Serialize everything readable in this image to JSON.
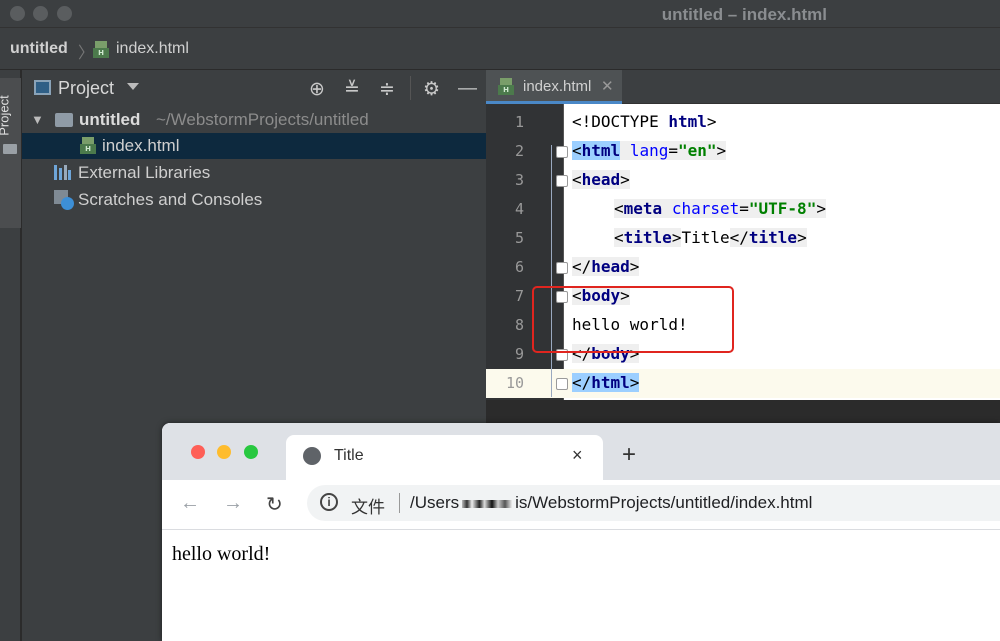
{
  "ide": {
    "window_title": "untitled – index.html",
    "breadcrumb": {
      "project": "untitled",
      "file": "index.html"
    },
    "left_stripe": {
      "label": "Project"
    },
    "project_panel": {
      "title": "Project",
      "tree": [
        {
          "label": "untitled",
          "path": "~/WebstormProjects/untitled",
          "type": "folder"
        },
        {
          "label": "index.html",
          "type": "html-file"
        },
        {
          "label": "External Libraries",
          "type": "libraries"
        },
        {
          "label": "Scratches and Consoles",
          "type": "scratches"
        }
      ]
    },
    "editor": {
      "tab_label": "index.html",
      "line_numbers": [
        "1",
        "2",
        "3",
        "4",
        "5",
        "6",
        "7",
        "8",
        "9",
        "10"
      ],
      "code": {
        "l1_open": "<!DOCTYPE ",
        "l1_kw": "html",
        "l1_close": ">",
        "l2_tag": "html",
        "l2_attr": "lang",
        "l2_val": "\"en\"",
        "l3_tag": "head",
        "l4_tag": "meta",
        "l4_attr": "charset",
        "l4_val": "\"UTF-8\"",
        "l5_tag": "title",
        "l5_text": "Title",
        "l6_tag": "head",
        "l7_tag": "body",
        "l8_text": "hello world!",
        "l9_tag": "body",
        "l10_tag": "html"
      }
    }
  },
  "browser": {
    "tab_title": "Title",
    "tab_close": "×",
    "new_tab": "+",
    "url_scheme": "文件",
    "url_prefix": "/Users",
    "url_rest": "is/WebstormProjects/untitled/index.html",
    "page_text": "hello world!"
  },
  "colors": {
    "annotation_box": "#e0251f",
    "selection_blue": "#9ccfff",
    "traffic_red": "#fe5f57",
    "traffic_yellow": "#febc2e",
    "traffic_green": "#28c840"
  }
}
